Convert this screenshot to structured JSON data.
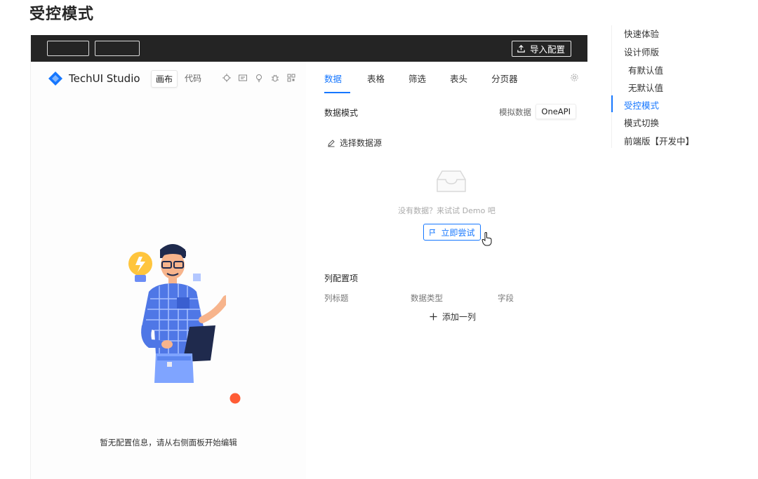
{
  "page": {
    "title": "受控模式"
  },
  "topbar": {
    "import_label": "导入配置"
  },
  "canvas": {
    "brand": "TechUI Studio",
    "view_tabs": [
      "画布",
      "代码"
    ],
    "empty_text": "暂无配置信息，请从右侧面板开始编辑"
  },
  "config": {
    "tabs": [
      "数据",
      "表格",
      "筛选",
      "表头",
      "分页器"
    ],
    "data_mode_title": "数据模式",
    "mock_label": "模拟数据",
    "oneapi_label": "OneAPI",
    "choose_source": "选择数据源",
    "no_data": "没有数据？来试试 Demo 吧",
    "try_now": "立即尝试",
    "columns_title": "列配置项",
    "column_headers": [
      "列标题",
      "数据类型",
      "字段"
    ],
    "add_column": "添加一列"
  },
  "toc": {
    "items": [
      "快速体验",
      "设计师版",
      "有默认值",
      "无默认值",
      "受控模式",
      "模式切换",
      "前端版【开发中】"
    ],
    "active": "受控模式"
  },
  "colors": {
    "accent": "#1677ff",
    "topbar": "#242424"
  }
}
